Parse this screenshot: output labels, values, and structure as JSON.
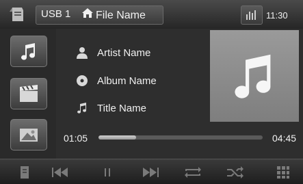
{
  "topbar": {
    "source_label": "USB 1",
    "folder_label": "File Name",
    "clock": "11:30",
    "icons": [
      "home-icon",
      "equalizer-icon",
      "back-icon"
    ]
  },
  "sidebar": {
    "items": [
      {
        "icon": "music-note-icon",
        "selected": true
      },
      {
        "icon": "video-clapper-icon",
        "selected": false
      },
      {
        "icon": "photo-icon",
        "selected": false
      }
    ]
  },
  "track": {
    "artist": "Artist Name",
    "album": "Album Name",
    "title": "Title Name"
  },
  "playback": {
    "elapsed": "01:05",
    "total": "04:45",
    "progress_fraction": 0.23
  },
  "controls": [
    "menu-icon",
    "previous-icon",
    "pause-icon",
    "next-icon",
    "repeat-icon",
    "shuffle-icon",
    "grid-icon"
  ],
  "colors": {
    "background": "#2a2a2a",
    "accent": "#d8d8d8",
    "album_art": "#8c8c8c"
  }
}
